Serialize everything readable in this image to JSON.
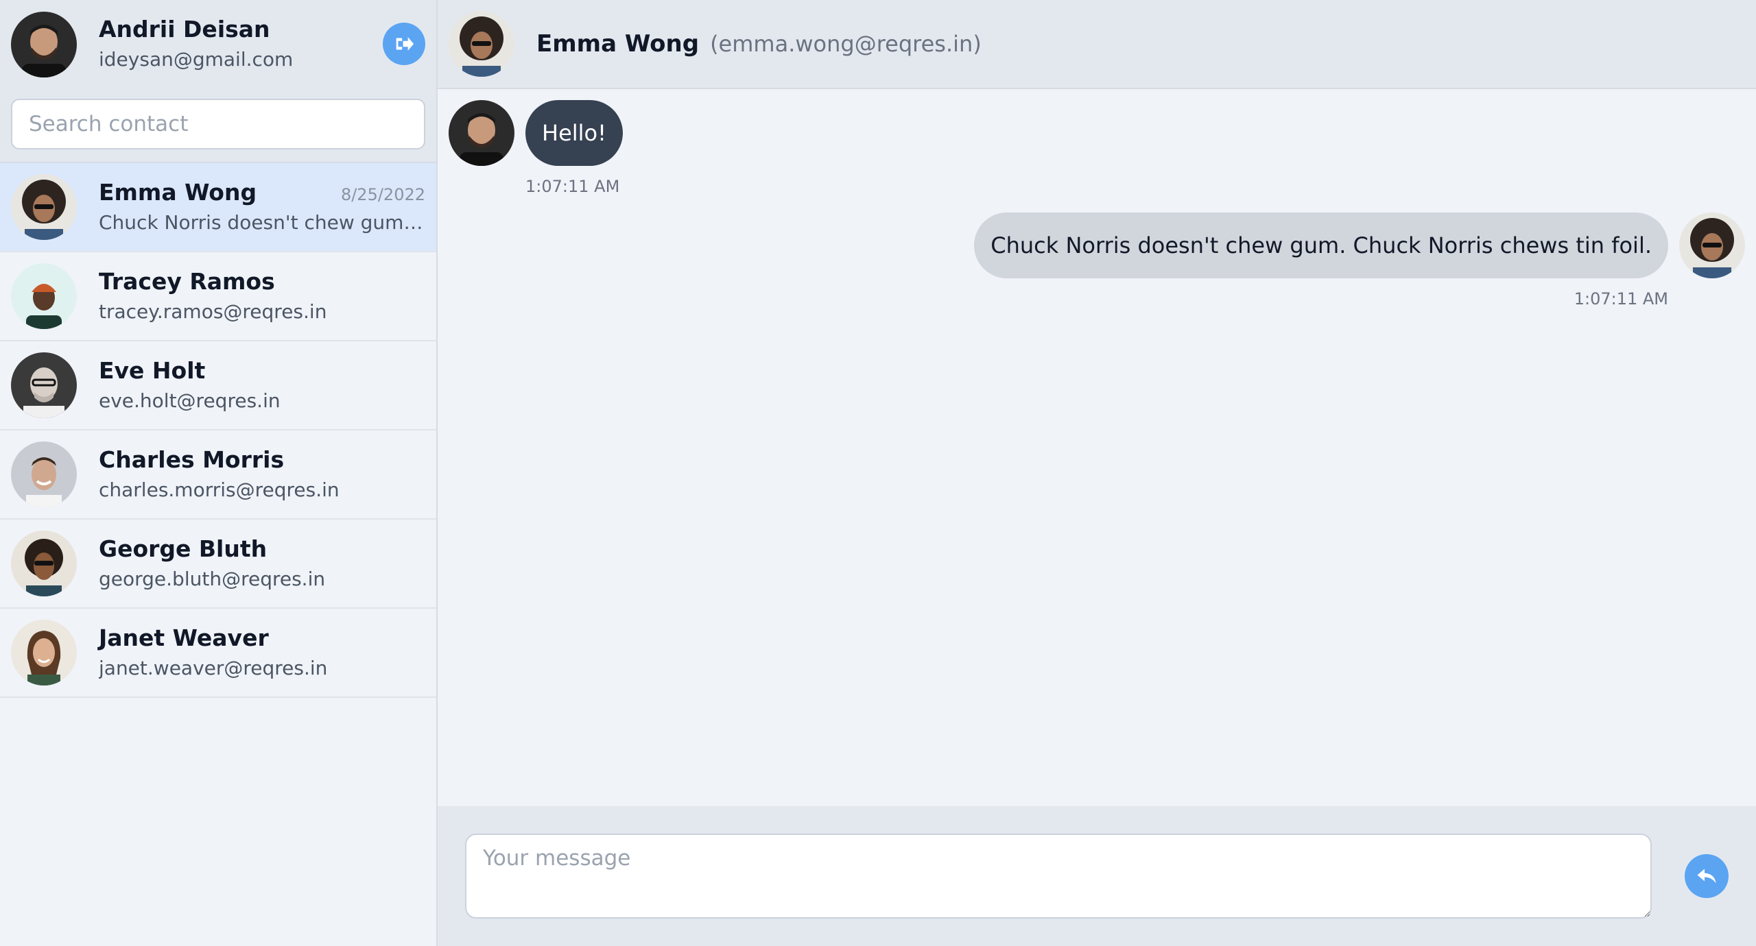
{
  "current_user": {
    "name": "Andrii Deisan",
    "email": "ideysan@gmail.com",
    "avatar_icon": "user-avatar-man-beard"
  },
  "search": {
    "placeholder": "Search contact",
    "value": ""
  },
  "contacts": [
    {
      "name": "Emma Wong",
      "subtitle": "Chuck Norris doesn't chew gum. Chuck Norris chews tin foil.",
      "date": "8/25/2022",
      "active": true,
      "avatar_icon": "avatar-woman-curly-sunglasses"
    },
    {
      "name": "Tracey Ramos",
      "subtitle": "tracey.ramos@reqres.in",
      "date": "",
      "active": false,
      "avatar_icon": "avatar-man-orange-beanie"
    },
    {
      "name": "Eve Holt",
      "subtitle": "eve.holt@reqres.in",
      "date": "",
      "active": false,
      "avatar_icon": "avatar-bald-man-glasses"
    },
    {
      "name": "Charles Morris",
      "subtitle": "charles.morris@reqres.in",
      "date": "",
      "active": false,
      "avatar_icon": "avatar-man-smiling"
    },
    {
      "name": "George Bluth",
      "subtitle": "george.bluth@reqres.in",
      "date": "",
      "active": false,
      "avatar_icon": "avatar-man-curly-sunglasses"
    },
    {
      "name": "Janet Weaver",
      "subtitle": "janet.weaver@reqres.in",
      "date": "",
      "active": false,
      "avatar_icon": "avatar-woman-smiling"
    }
  ],
  "chat": {
    "header_name": "Emma Wong",
    "header_email": "(emma.wong@reqres.in)",
    "messages": [
      {
        "direction": "in",
        "text": "Hello!",
        "time": "1:07:11 AM"
      },
      {
        "direction": "out",
        "text": "Chuck Norris doesn't chew gum. Chuck Norris chews tin foil.",
        "time": "1:07:11 AM"
      }
    ]
  },
  "composer": {
    "placeholder": "Your message",
    "value": ""
  },
  "colors": {
    "accent": "#5ba4f2",
    "active_contact": "#dbe8fb",
    "dark_bubble": "#364152",
    "light_bubble": "#d1d5dc"
  },
  "icons": {
    "logout": "logout-arrow-icon",
    "send": "reply-arrow-icon"
  }
}
